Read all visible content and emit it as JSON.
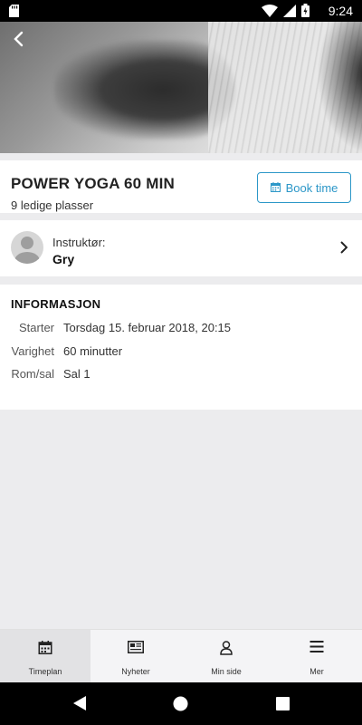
{
  "status_bar": {
    "time": "9:24"
  },
  "class": {
    "title": "POWER YOGA 60 MIN",
    "spots": "9 ledige plasser",
    "book_label": "Book time"
  },
  "instructor": {
    "label": "Instruktør:",
    "name": "Gry"
  },
  "info": {
    "heading": "INFORMASJON",
    "rows": [
      {
        "key": "Starter",
        "value": "Torsdag 15. februar 2018, 20:15"
      },
      {
        "key": "Varighet",
        "value": "60 minutter"
      },
      {
        "key": "Rom/sal",
        "value": "Sal 1"
      }
    ]
  },
  "tabs": [
    {
      "label": "Timeplan",
      "icon": "calendar-icon",
      "active": true
    },
    {
      "label": "Nyheter",
      "icon": "newspaper-icon",
      "active": false
    },
    {
      "label": "Min side",
      "icon": "person-icon",
      "active": false
    },
    {
      "label": "Mer",
      "icon": "menu-icon",
      "active": false
    }
  ],
  "colors": {
    "accent": "#2c97c8"
  }
}
